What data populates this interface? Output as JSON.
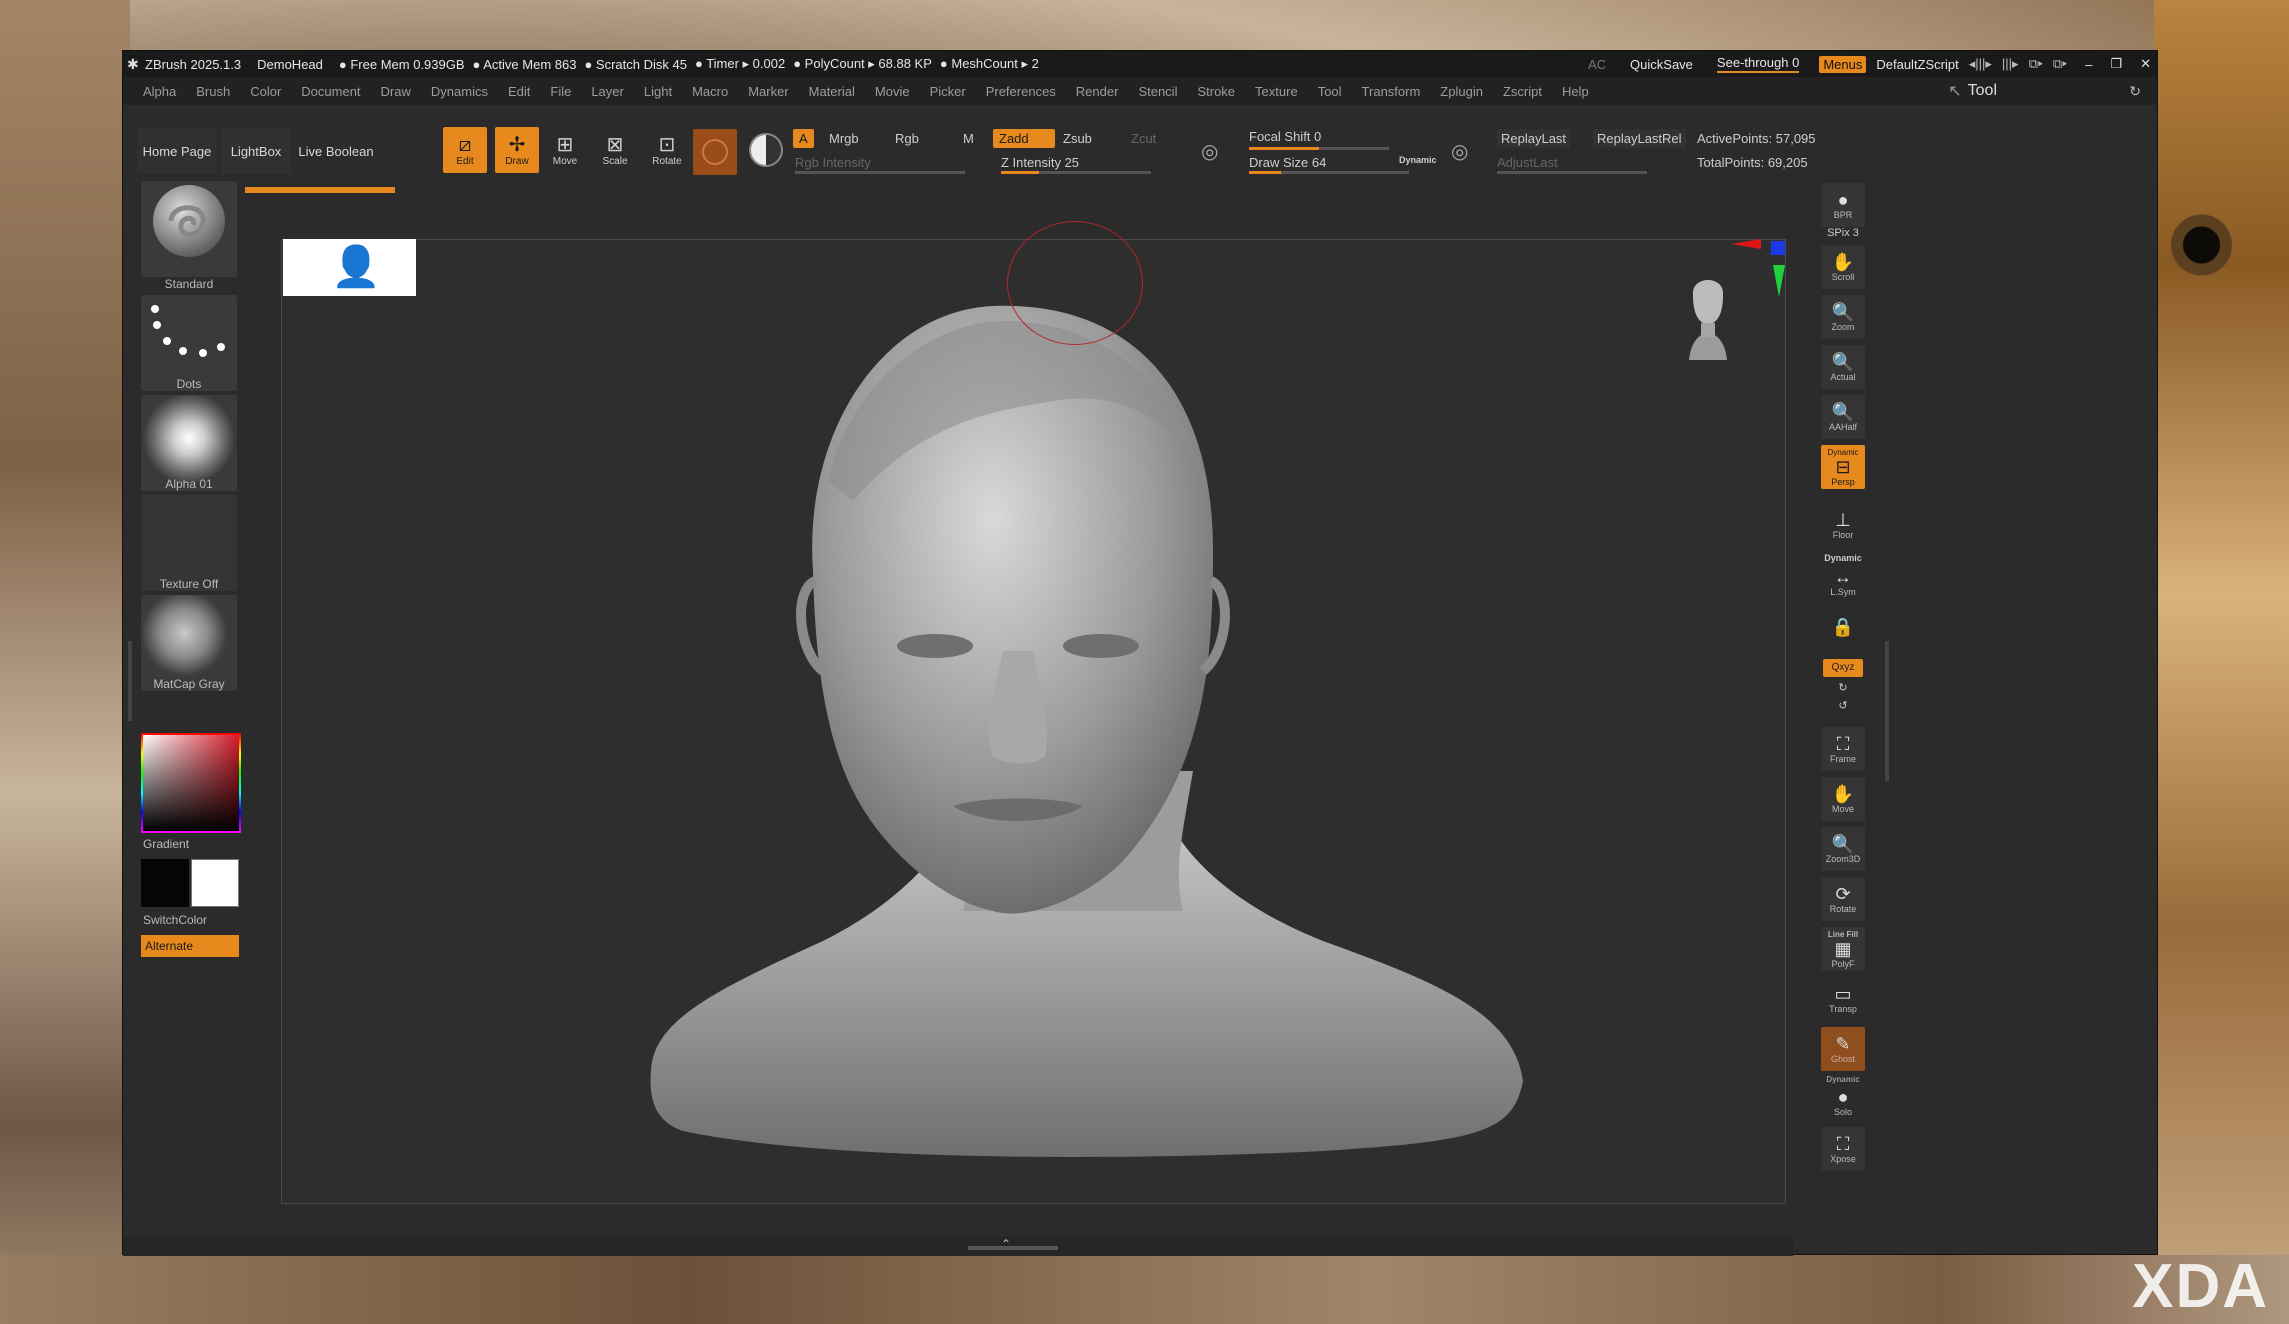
{
  "titlebar": {
    "app": "ZBrush 2025.1.3",
    "project": "DemoHead",
    "free_mem": "● Free Mem 0.939GB",
    "active_mem": "● Active Mem 863",
    "scratch": "● Scratch Disk 45",
    "timer": "● Timer ▸ 0.002",
    "polycount": "● PolyCount ▸ 68.88 KP",
    "meshcount": "● MeshCount ▸ 2",
    "ac": "AC",
    "quicksave": "QuickSave",
    "seethrough": "See-through  0",
    "menus": "Menus",
    "defaultzscript": "DefaultZScript"
  },
  "menubar": [
    "Alpha",
    "Brush",
    "Color",
    "Document",
    "Draw",
    "Dynamics",
    "Edit",
    "File",
    "Layer",
    "Light",
    "Macro",
    "Marker",
    "Material",
    "Movie",
    "Picker",
    "Preferences",
    "Render",
    "Stencil",
    "Stroke",
    "Texture",
    "Tool",
    "Transform",
    "Zplugin",
    "Zscript",
    "Help"
  ],
  "tool_panel": {
    "title": "Tool"
  },
  "toolbar": {
    "home": "Home Page",
    "lightbox": "LightBox",
    "live_boolean": "Live Boolean",
    "edit": "Edit",
    "draw": "Draw",
    "move": "Move",
    "scale": "Scale",
    "rotate": "Rotate",
    "a": "A",
    "mrgb": "Mrgb",
    "rgb": "Rgb",
    "m": "M",
    "rgb_intensity": "Rgb Intensity",
    "zadd": "Zadd",
    "zsub": "Zsub",
    "zcut": "Zcut",
    "z_intensity": "Z Intensity 25",
    "focal_shift": "Focal Shift 0",
    "draw_size": "Draw Size 64",
    "dynamic": "Dynamic",
    "replaylast": "ReplayLast",
    "replaylastrel": "ReplayLastRel",
    "adjustlast": "AdjustLast",
    "active_points": "ActivePoints: 57,095",
    "total_points": "TotalPoints: 69,205",
    "z_intensity_value": 0.25,
    "draw_size_fill": 0.2,
    "focal_shift_fill": 0.5
  },
  "leftpanel": {
    "standard": "Standard",
    "dots": "Dots",
    "alpha": "Alpha 01",
    "texture": "Texture Off",
    "matcap": "MatCap Gray",
    "gradient": "Gradient",
    "switchcolor": "SwitchColor",
    "alternate": "Alternate"
  },
  "rightdock": {
    "bpr": "BPR",
    "spix": "SPix 3",
    "scroll": "Scroll",
    "zoom": "Zoom",
    "actual": "Actual",
    "aahalf": "AAHalf",
    "dynamic_persp": "Dynamic",
    "persp": "Persp",
    "floor": "Floor",
    "dynamic2": "Dynamic",
    "lsym": "L.Sym",
    "xyz": "Qxyz",
    "frame": "Frame",
    "move": "Move",
    "zoom3d": "Zoom3D",
    "rotate": "Rotate",
    "linefill": "Line Fill",
    "polyf": "PolyF",
    "transp": "Transp",
    "ghost": "Ghost",
    "dynamic3": "Dynamic",
    "solo": "Solo",
    "xpose": "Xpose"
  },
  "watermark": "XDA",
  "colors": {
    "accent": "#e8891e",
    "bg": "#2b2b2b",
    "canvas": "#2e2e2e"
  }
}
